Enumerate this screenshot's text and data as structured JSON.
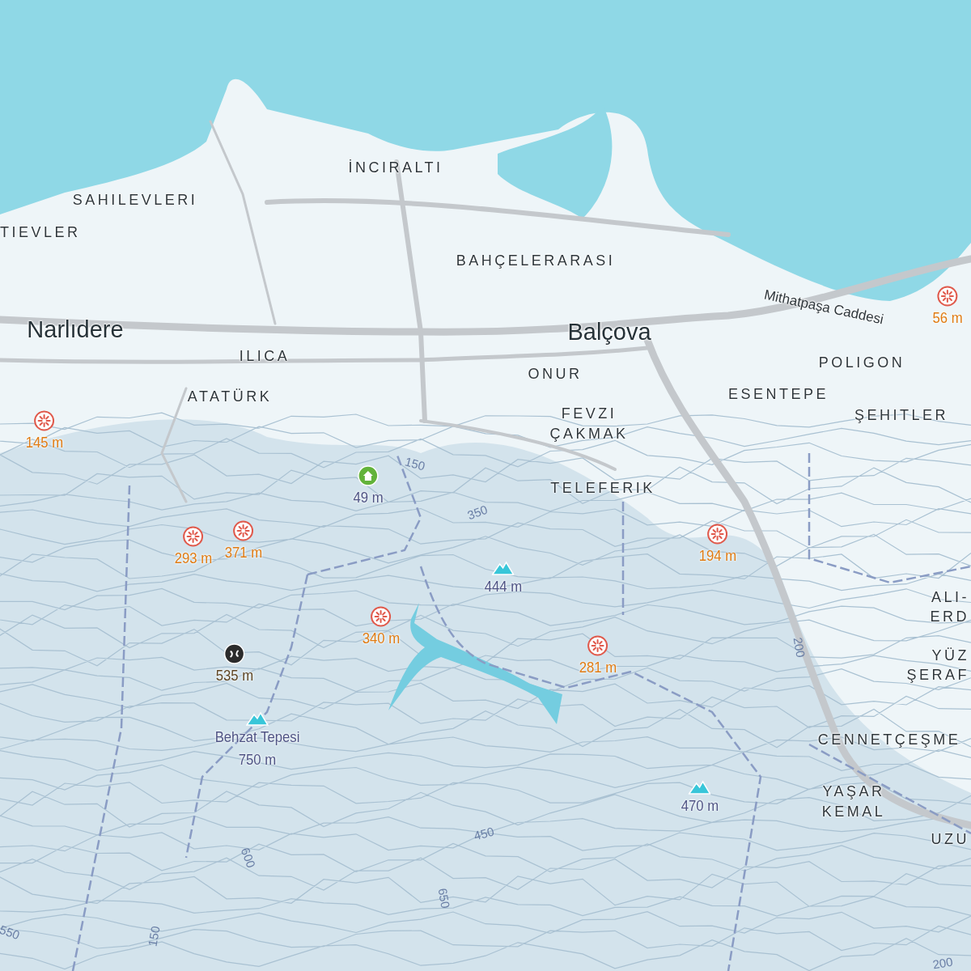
{
  "cities": [
    {
      "name": "Narlıdere"
    },
    {
      "name": "Balçova"
    }
  ],
  "districts": [
    {
      "name": "SAHILEVLERI"
    },
    {
      "name": "TIEVLER"
    },
    {
      "name": "İNCIRALTI"
    },
    {
      "name": "BAHÇELERARASI"
    },
    {
      "name": "ILICA"
    },
    {
      "name": "ATATÜRK"
    },
    {
      "name": "ONUR"
    },
    {
      "name": "FEVZI ÇAKMAK"
    },
    {
      "name": "TELEFERIK"
    },
    {
      "name": "POLIGON"
    },
    {
      "name": "ESENTEPE"
    },
    {
      "name": "ŞEHITLER"
    },
    {
      "name": "ALI-"
    },
    {
      "name": "ERD"
    },
    {
      "name": "YÜZ"
    },
    {
      "name": "ŞERAF"
    },
    {
      "name": "CENNETÇEŞME"
    },
    {
      "name": "YAŞAR KEMAL"
    },
    {
      "name": "UZU"
    }
  ],
  "streets": [
    {
      "name": "Mithatpaşa Caddesi"
    }
  ],
  "pois": [
    {
      "kind": "viewpoint",
      "label": "145 m"
    },
    {
      "kind": "viewpoint",
      "label": "293 m"
    },
    {
      "kind": "viewpoint",
      "label": "371 m"
    },
    {
      "kind": "viewpoint",
      "label": "340 m"
    },
    {
      "kind": "viewpoint",
      "label": "281 m"
    },
    {
      "kind": "viewpoint",
      "label": "194 m"
    },
    {
      "kind": "viewpoint",
      "label": "56 m"
    },
    {
      "kind": "peak",
      "label": "444 m"
    },
    {
      "kind": "peak",
      "label": "Behzat Tepesi 750 m"
    },
    {
      "kind": "peak",
      "label": "470 m"
    },
    {
      "kind": "home",
      "label": "49 m"
    },
    {
      "kind": "climbing",
      "label": "535 m"
    }
  ],
  "contours": [
    {
      "label": "150"
    },
    {
      "label": "350"
    },
    {
      "label": "450"
    },
    {
      "label": "600"
    },
    {
      "label": "650"
    },
    {
      "label": "550"
    },
    {
      "label": "150"
    },
    {
      "label": "200"
    },
    {
      "label": "200"
    }
  ]
}
